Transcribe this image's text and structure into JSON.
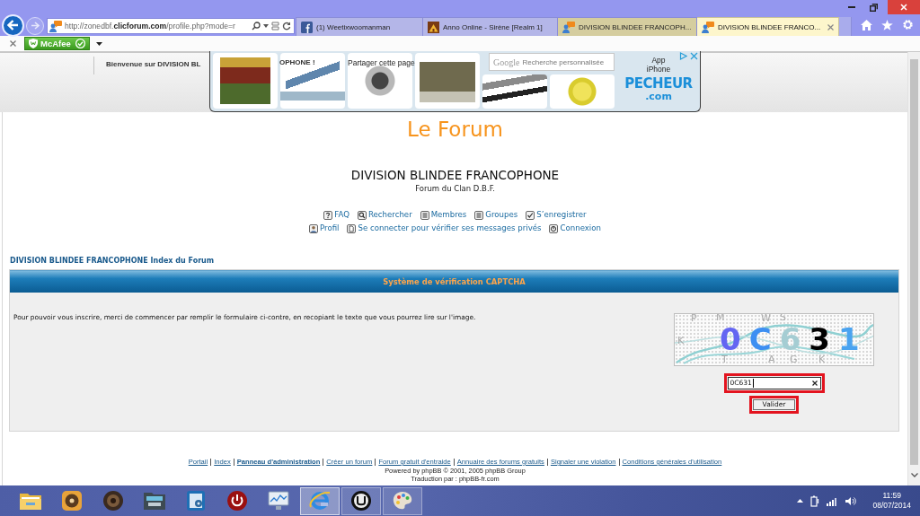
{
  "browser": {
    "back_button": {
      "disabled": false
    },
    "forward_button": {
      "disabled": true
    },
    "address_bar": {
      "url": "http://zonedbf.**clicforum.com**/profile.php?mode=r"
    },
    "tabs": [
      {
        "title": "(1) Weetixwoomanman",
        "selected": false,
        "color": "#b4b6e8"
      },
      {
        "title": "Anno Online - Sirène [Realm 1]",
        "selected": false,
        "color": "#b4b6e8"
      },
      {
        "title": "DIVISION BLINDEE FRANCOPH...",
        "selected": false,
        "color": "#d5cd9f"
      },
      {
        "title": "DIVISION BLINDEE FRANCO...",
        "selected": true,
        "color": "#fdf6cc"
      }
    ],
    "toolbar": {
      "mcafee_button": {
        "label": "McAfee"
      }
    }
  },
  "page": {
    "welcome_bar": {
      "text": "Bienvenue sur DIVISION BL",
      "text_continued": "OPHONE !",
      "share_label": "Partager cette page"
    },
    "ad_banner": {
      "search_field": {
        "brand": "Google",
        "placeholder": "Recherche personnalisée"
      },
      "app_label": "App iPhone",
      "logo": "PECHEUR",
      "logo_suffix": ".com"
    },
    "forum": {
      "logo_text": "Le Forum",
      "title": "DIVISION BLINDEE FRANCOPHONE",
      "subtitle": "Forum du Clan D.B.F.",
      "nav_rows": [
        [
          "FAQ",
          "Rechercher",
          "Membres",
          "Groupes",
          "S’enregistrer"
        ],
        [
          "Profil",
          "Se connecter pour vérifier ses messages privés",
          "Connexion"
        ]
      ],
      "breadcrumb": "DIVISION BLINDEE FRANCOPHONE Index du Forum",
      "captcha_panel": {
        "title": "Système de vérification CAPTCHA",
        "instructions": "Pour pouvoir vous inscrire, merci de commencer par remplir le formulaire ci-contre, en recopiant le texte que vous pourrez lire sur l'image.",
        "captcha_image": {
          "characters": [
            {
              "char": "0",
              "color": "#6466f2"
            },
            {
              "char": "C",
              "color": "#3d8ff2"
            },
            {
              "char": "6",
              "color": "#a5cdd3"
            },
            {
              "char": "3",
              "color": "#000000"
            },
            {
              "char": "1",
              "color": "#4aa3f0"
            }
          ],
          "background_letters": [
            "P",
            "M",
            "W",
            "S",
            "K",
            "T",
            "A",
            "G",
            "K"
          ]
        },
        "answer_field": {
          "value": "0C631",
          "focused": true,
          "highlighted": true
        },
        "submit_button": {
          "label": "Valider",
          "highlighted": true
        }
      },
      "footer": {
        "links": [
          {
            "label": "Portail",
            "bold": false
          },
          {
            "label": "Index",
            "bold": false
          },
          {
            "label": "Panneau d'administration",
            "bold": true
          },
          {
            "label": "Créer un forum",
            "bold": false
          },
          {
            "label": "Forum gratuit d'entraide",
            "bold": false
          },
          {
            "label": "Annuaire des forums gratuits",
            "bold": false
          },
          {
            "label": "Signaler une violation",
            "bold": false
          },
          {
            "label": "Conditions générales d'utilisation",
            "bold": false
          }
        ],
        "powered_by": "Powered by phpBB © 2001, 2005 phpBB Group",
        "translation": "Traduction par : phpBB-fr.com"
      }
    }
  },
  "taskbar": {
    "apps": [
      {
        "running": false,
        "selected": false
      },
      {
        "running": false,
        "selected": false
      },
      {
        "running": false,
        "selected": false
      },
      {
        "running": false,
        "selected": false
      },
      {
        "running": false,
        "selected": false
      },
      {
        "running": false,
        "selected": false
      },
      {
        "running": false,
        "selected": false
      },
      {
        "running": true,
        "selected": true
      },
      {
        "running": true,
        "selected": false
      },
      {
        "running": true,
        "selected": false
      }
    ],
    "clock": {
      "time": "11:59",
      "date": "08/07/2014"
    }
  }
}
